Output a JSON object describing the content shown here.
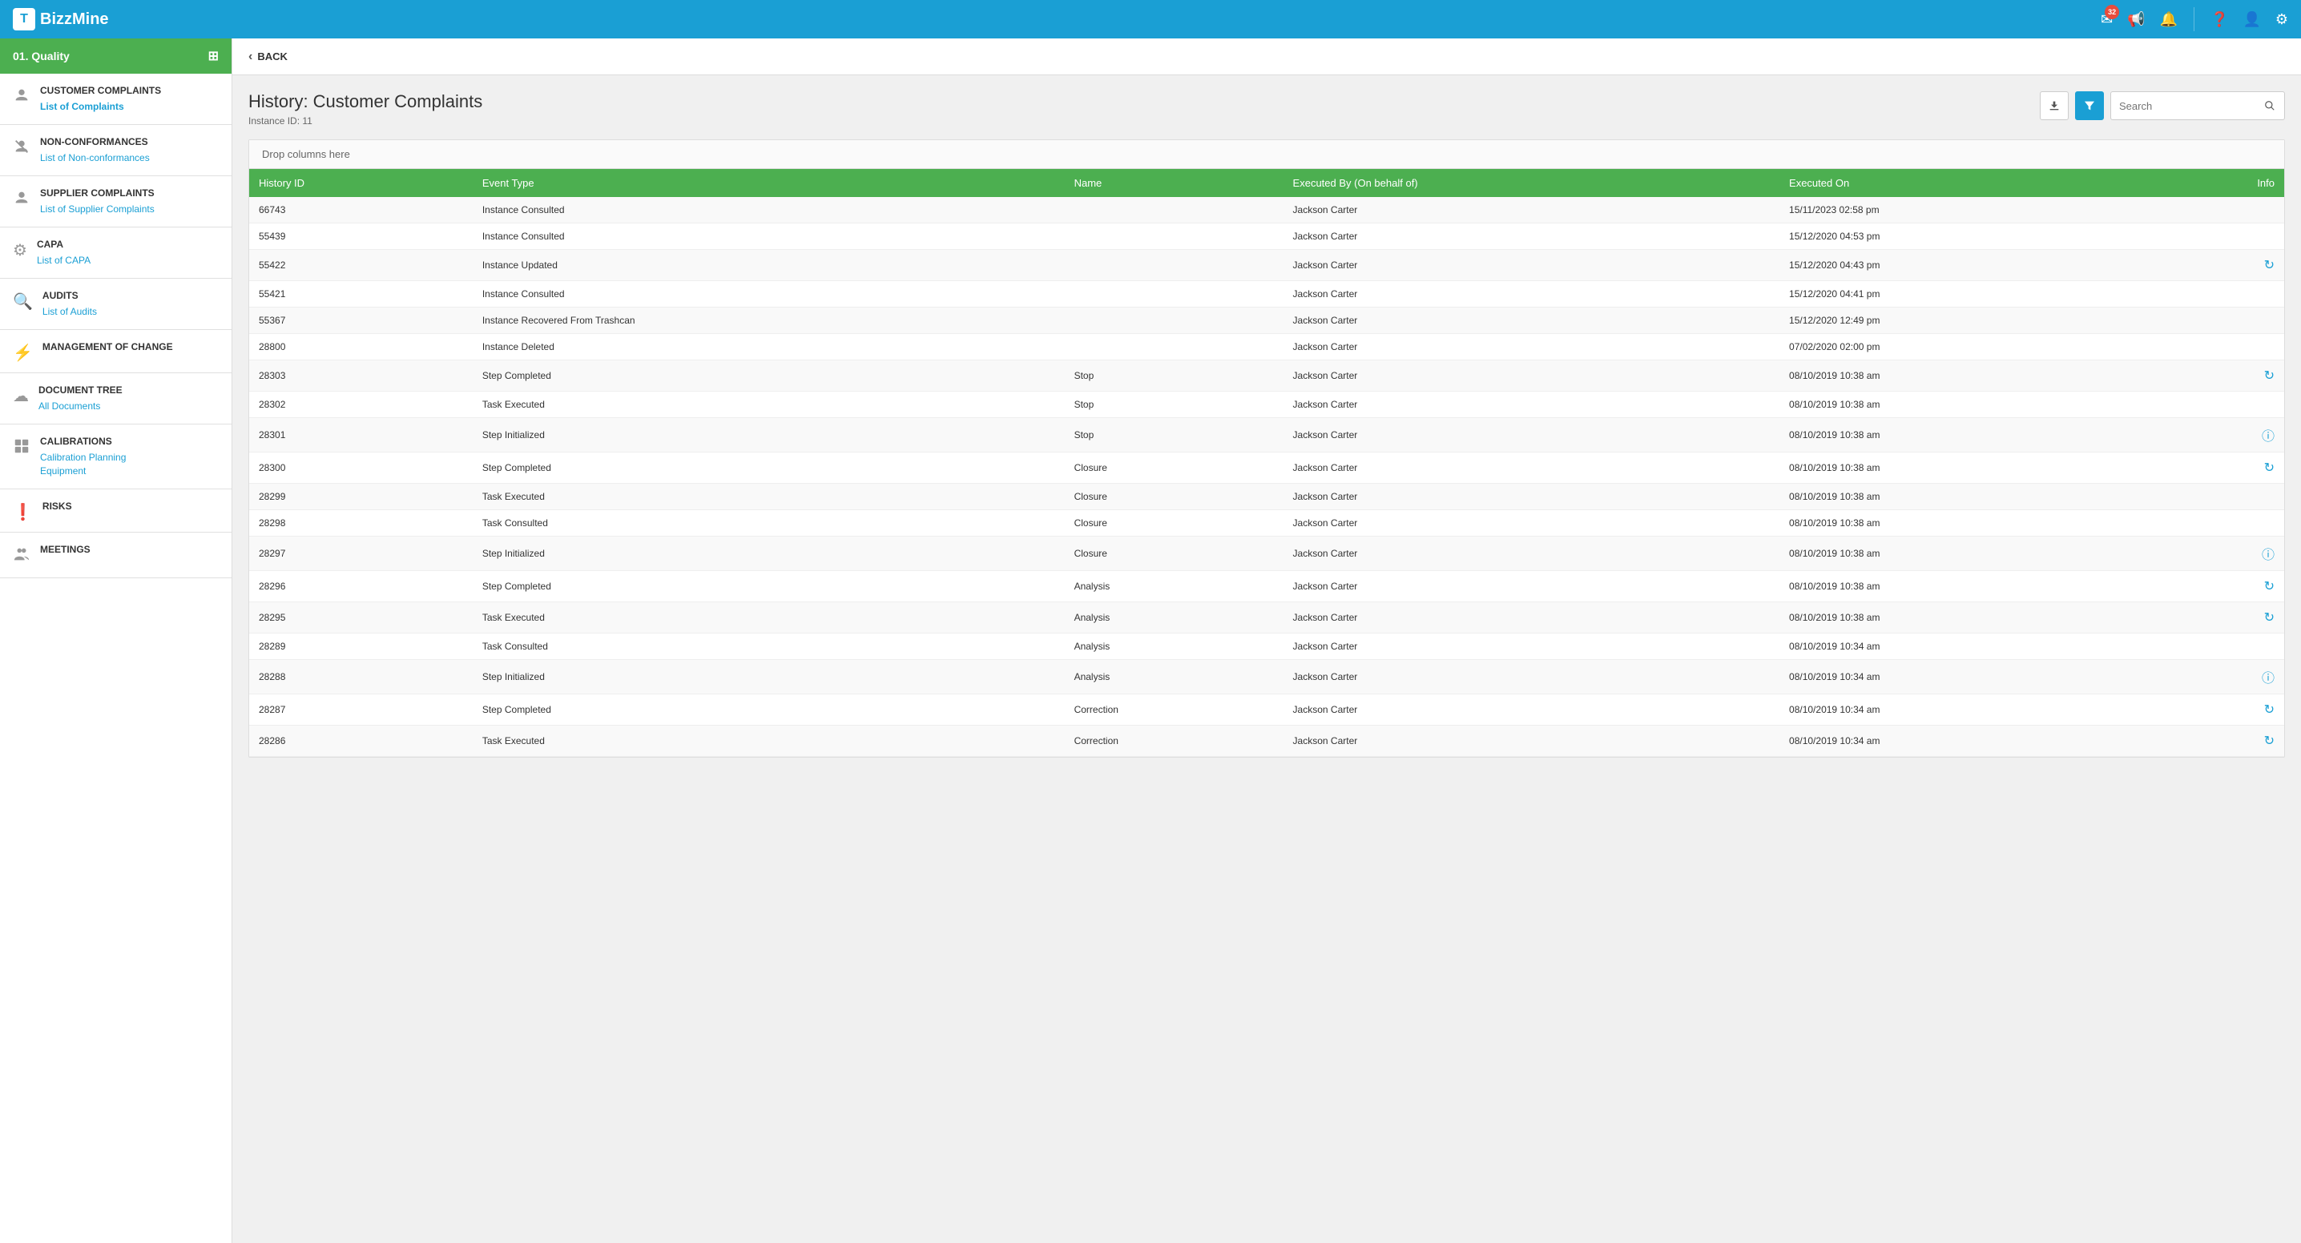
{
  "topnav": {
    "logo_text": "BizzMine",
    "badge_count": "32",
    "icons": [
      "mail",
      "megaphone",
      "bell",
      "question",
      "user",
      "gear"
    ]
  },
  "sidebar": {
    "module_button": "01. Quality",
    "sections": [
      {
        "id": "customer-complaints",
        "icon": "face",
        "title": "CUSTOMER COMPLAINTS",
        "links": [
          {
            "label": "List of Complaints",
            "active": true
          }
        ]
      },
      {
        "id": "non-conformances",
        "icon": "warning",
        "title": "NON-CONFORMANCES",
        "links": [
          {
            "label": "List of Non-conformances",
            "active": false
          }
        ]
      },
      {
        "id": "supplier-complaints",
        "icon": "face-unhappy",
        "title": "SUPPLIER COMPLAINTS",
        "links": [
          {
            "label": "List of Supplier Complaints",
            "active": false
          }
        ]
      },
      {
        "id": "capa",
        "icon": "gear",
        "title": "CAPA",
        "links": [
          {
            "label": "List of CAPA",
            "active": false
          }
        ]
      },
      {
        "id": "audits",
        "icon": "search",
        "title": "AUDITS",
        "links": [
          {
            "label": "List of Audits",
            "active": false
          }
        ]
      },
      {
        "id": "management-of-change",
        "icon": "lightning",
        "title": "MANAGEMENT OF CHANGE",
        "links": []
      },
      {
        "id": "document-tree",
        "icon": "cloud",
        "title": "DOCUMENT TREE",
        "links": [
          {
            "label": "All Documents",
            "active": false
          }
        ]
      },
      {
        "id": "calibrations",
        "icon": "calibration",
        "title": "CALIBRATIONS",
        "links": [
          {
            "label": "Calibration Planning",
            "active": false
          },
          {
            "label": "Equipment",
            "active": false
          }
        ]
      },
      {
        "id": "risks",
        "icon": "question",
        "title": "RISKS",
        "links": []
      },
      {
        "id": "meetings",
        "icon": "meetings",
        "title": "MEETINGS",
        "links": []
      }
    ]
  },
  "topbar": {
    "back_label": "BACK"
  },
  "content": {
    "title": "History: Customer Complaints",
    "instance_label": "Instance ID: 11",
    "drop_columns_text": "Drop columns here",
    "search_placeholder": "Search",
    "columns": [
      "History ID",
      "Event Type",
      "Name",
      "Executed By (On behalf of)",
      "Executed On",
      "Info"
    ],
    "rows": [
      {
        "id": "66743",
        "event": "Instance Consulted",
        "name": "",
        "executed_by": "Jackson Carter",
        "executed_on": "15/11/2023 02:58 pm",
        "info": ""
      },
      {
        "id": "55439",
        "event": "Instance Consulted",
        "name": "",
        "executed_by": "Jackson Carter",
        "executed_on": "15/12/2020 04:53 pm",
        "info": ""
      },
      {
        "id": "55422",
        "event": "Instance Updated",
        "name": "",
        "executed_by": "Jackson Carter",
        "executed_on": "15/12/2020 04:43 pm",
        "info": "refresh"
      },
      {
        "id": "55421",
        "event": "Instance Consulted",
        "name": "",
        "executed_by": "Jackson Carter",
        "executed_on": "15/12/2020 04:41 pm",
        "info": ""
      },
      {
        "id": "55367",
        "event": "Instance Recovered From Trashcan",
        "name": "",
        "executed_by": "Jackson Carter",
        "executed_on": "15/12/2020 12:49 pm",
        "info": ""
      },
      {
        "id": "28800",
        "event": "Instance Deleted",
        "name": "",
        "executed_by": "Jackson Carter",
        "executed_on": "07/02/2020 02:00 pm",
        "info": ""
      },
      {
        "id": "28303",
        "event": "Step Completed",
        "name": "Stop",
        "executed_by": "Jackson Carter",
        "executed_on": "08/10/2019 10:38 am",
        "info": "refresh"
      },
      {
        "id": "28302",
        "event": "Task Executed",
        "name": "Stop",
        "executed_by": "Jackson Carter",
        "executed_on": "08/10/2019 10:38 am",
        "info": ""
      },
      {
        "id": "28301",
        "event": "Step Initialized",
        "name": "Stop",
        "executed_by": "Jackson Carter",
        "executed_on": "08/10/2019 10:38 am",
        "info": "info"
      },
      {
        "id": "28300",
        "event": "Step Completed",
        "name": "Closure",
        "executed_by": "Jackson Carter",
        "executed_on": "08/10/2019 10:38 am",
        "info": "refresh"
      },
      {
        "id": "28299",
        "event": "Task Executed",
        "name": "Closure",
        "executed_by": "Jackson Carter",
        "executed_on": "08/10/2019 10:38 am",
        "info": ""
      },
      {
        "id": "28298",
        "event": "Task Consulted",
        "name": "Closure",
        "executed_by": "Jackson Carter",
        "executed_on": "08/10/2019 10:38 am",
        "info": ""
      },
      {
        "id": "28297",
        "event": "Step Initialized",
        "name": "Closure",
        "executed_by": "Jackson Carter",
        "executed_on": "08/10/2019 10:38 am",
        "info": "info"
      },
      {
        "id": "28296",
        "event": "Step Completed",
        "name": "Analysis",
        "executed_by": "Jackson Carter",
        "executed_on": "08/10/2019 10:38 am",
        "info": "refresh"
      },
      {
        "id": "28295",
        "event": "Task Executed",
        "name": "Analysis",
        "executed_by": "Jackson Carter",
        "executed_on": "08/10/2019 10:38 am",
        "info": "refresh"
      },
      {
        "id": "28289",
        "event": "Task Consulted",
        "name": "Analysis",
        "executed_by": "Jackson Carter",
        "executed_on": "08/10/2019 10:34 am",
        "info": ""
      },
      {
        "id": "28288",
        "event": "Step Initialized",
        "name": "Analysis",
        "executed_by": "Jackson Carter",
        "executed_on": "08/10/2019 10:34 am",
        "info": "info"
      },
      {
        "id": "28287",
        "event": "Step Completed",
        "name": "Correction",
        "executed_by": "Jackson Carter",
        "executed_on": "08/10/2019 10:34 am",
        "info": "refresh"
      },
      {
        "id": "28286",
        "event": "Task Executed",
        "name": "Correction",
        "executed_by": "Jackson Carter",
        "executed_on": "08/10/2019 10:34 am",
        "info": "refresh"
      }
    ]
  }
}
